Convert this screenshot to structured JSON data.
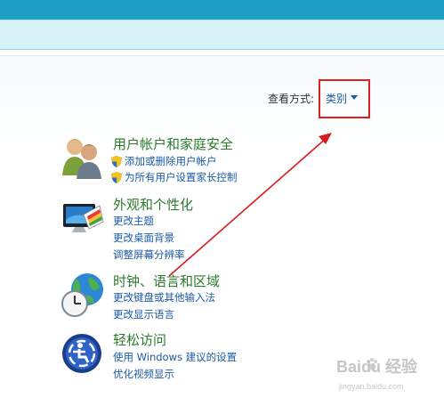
{
  "view_by": {
    "label": "查看方式:",
    "value": "类别"
  },
  "categories": [
    {
      "title": "用户帐户和家庭安全",
      "links": [
        "添加或删除用户帐户",
        "为所有用户设置家长控制"
      ]
    },
    {
      "title": "外观和个性化",
      "links": [
        "更改主题",
        "更改桌面背景",
        "调整屏幕分辨率"
      ]
    },
    {
      "title": "时钟、语言和区域",
      "links": [
        "更改键盘或其他输入法",
        "更改显示语言"
      ]
    },
    {
      "title": "轻松访问",
      "links": [
        "使用 Windows 建议的设置",
        "优化视频显示"
      ]
    }
  ],
  "watermark": {
    "brand": "Baidu",
    "text": "经验",
    "url": "jingyan.baidu.com"
  },
  "colors": {
    "title_green": "#2c7a2c",
    "link_blue": "#1b5aa5",
    "highlight_red": "#e02020",
    "top_band": "#1f9fc4"
  }
}
